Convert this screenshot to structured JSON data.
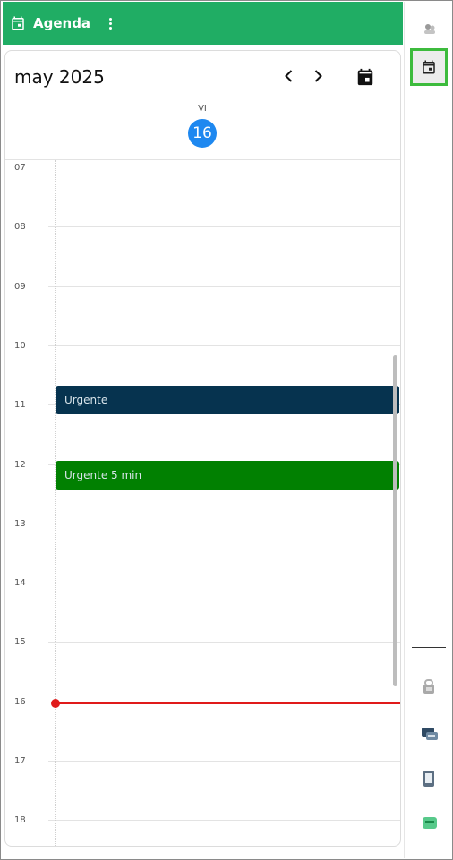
{
  "header": {
    "title": "Agenda",
    "color": "#20ad64"
  },
  "calendar": {
    "month_label": "may 2025",
    "day_name": "VI",
    "day_number": "16",
    "hours": [
      "07",
      "08",
      "09",
      "10",
      "11",
      "12",
      "13",
      "14",
      "15",
      "16",
      "17",
      "18"
    ],
    "events": [
      {
        "title": "Urgente",
        "color": "#06334f"
      },
      {
        "title": "Urgente 5 min",
        "color": "#018001"
      }
    ],
    "now_color": "#e01a1a",
    "today_color": "#1e88f0"
  },
  "rail": {
    "active_color": "#3dbb3d",
    "icons": [
      "people-icon",
      "calendar-icon",
      "lock-icon",
      "chat-icon",
      "phone-icon",
      "message-icon"
    ]
  }
}
